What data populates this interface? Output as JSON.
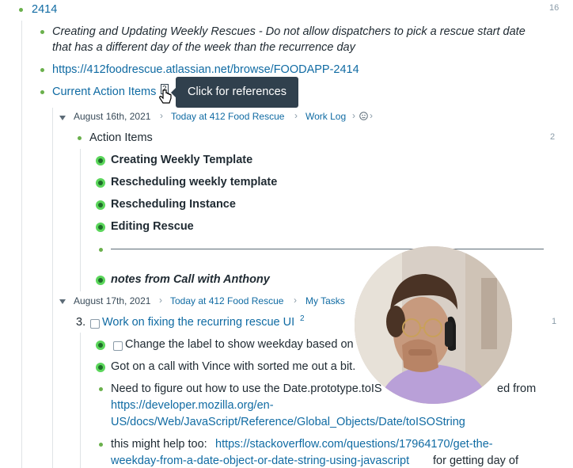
{
  "root": {
    "title": "2414",
    "count": "16"
  },
  "items": {
    "description": "Creating and Updating Weekly Rescues - Do not allow dispatchers to pick a rescue start date that has a different day of the week than the recurrence day",
    "description_line1": "Creating and Updating Weekly Rescues - Do not allow dispatchers to pick a rescue start date",
    "description_line2": "that has a different day of the week than the recurrence day",
    "jira_link": "https://412foodrescue.atlassian.net/browse/FOODAPP-2414",
    "current_action_items": "Current Action Items",
    "ref_count": "2",
    "tooltip": "Click for references"
  },
  "ref1": {
    "breadcrumb": [
      "August 16th, 2021",
      "Today at 412 Food Rescue",
      "Work Log"
    ],
    "sep": "›",
    "block": "Action Items",
    "block_count": "2",
    "children": [
      "Creating Weekly Template",
      "Rescheduling weekly template",
      "Rescheduling Instance",
      "Editing Rescue"
    ],
    "notes": "notes from Call with Anthony"
  },
  "ref2": {
    "breadcrumb": [
      "August 17th, 2021",
      "Today at 412 Food Rescue",
      "My Tasks"
    ],
    "task_number": "3.",
    "task_label": "Work on fixing the recurring rescue UI",
    "task_sup": "2",
    "task_count": "1",
    "children": {
      "c1": "Change the label to show weekday based on",
      "c2": "Got on a call with Vince with sorted me out a bit.",
      "c3_line1": "Need to figure out how to use the Date.prototype.toIS",
      "c3_line1_tail": "ed from",
      "c3_link_line1": "https://developer.mozilla.org/en-",
      "c3_link_line2": "US/docs/Web/JavaScript/Reference/Global_Objects/Date/toISOString",
      "c4_prefix": "this might help too: ",
      "c4_link_line1": "https://stackoverflow.com/questions/17964170/get-the-",
      "c4_link_line2": "weekday-from-a-date-object-or-date-string-using-javascript",
      "c4_suffix": " for getting day of"
    }
  },
  "colors": {
    "link": "#106ba3",
    "bullet": "#6ab04c",
    "done": "#5bd65b",
    "tooltip_bg": "#30404d"
  }
}
